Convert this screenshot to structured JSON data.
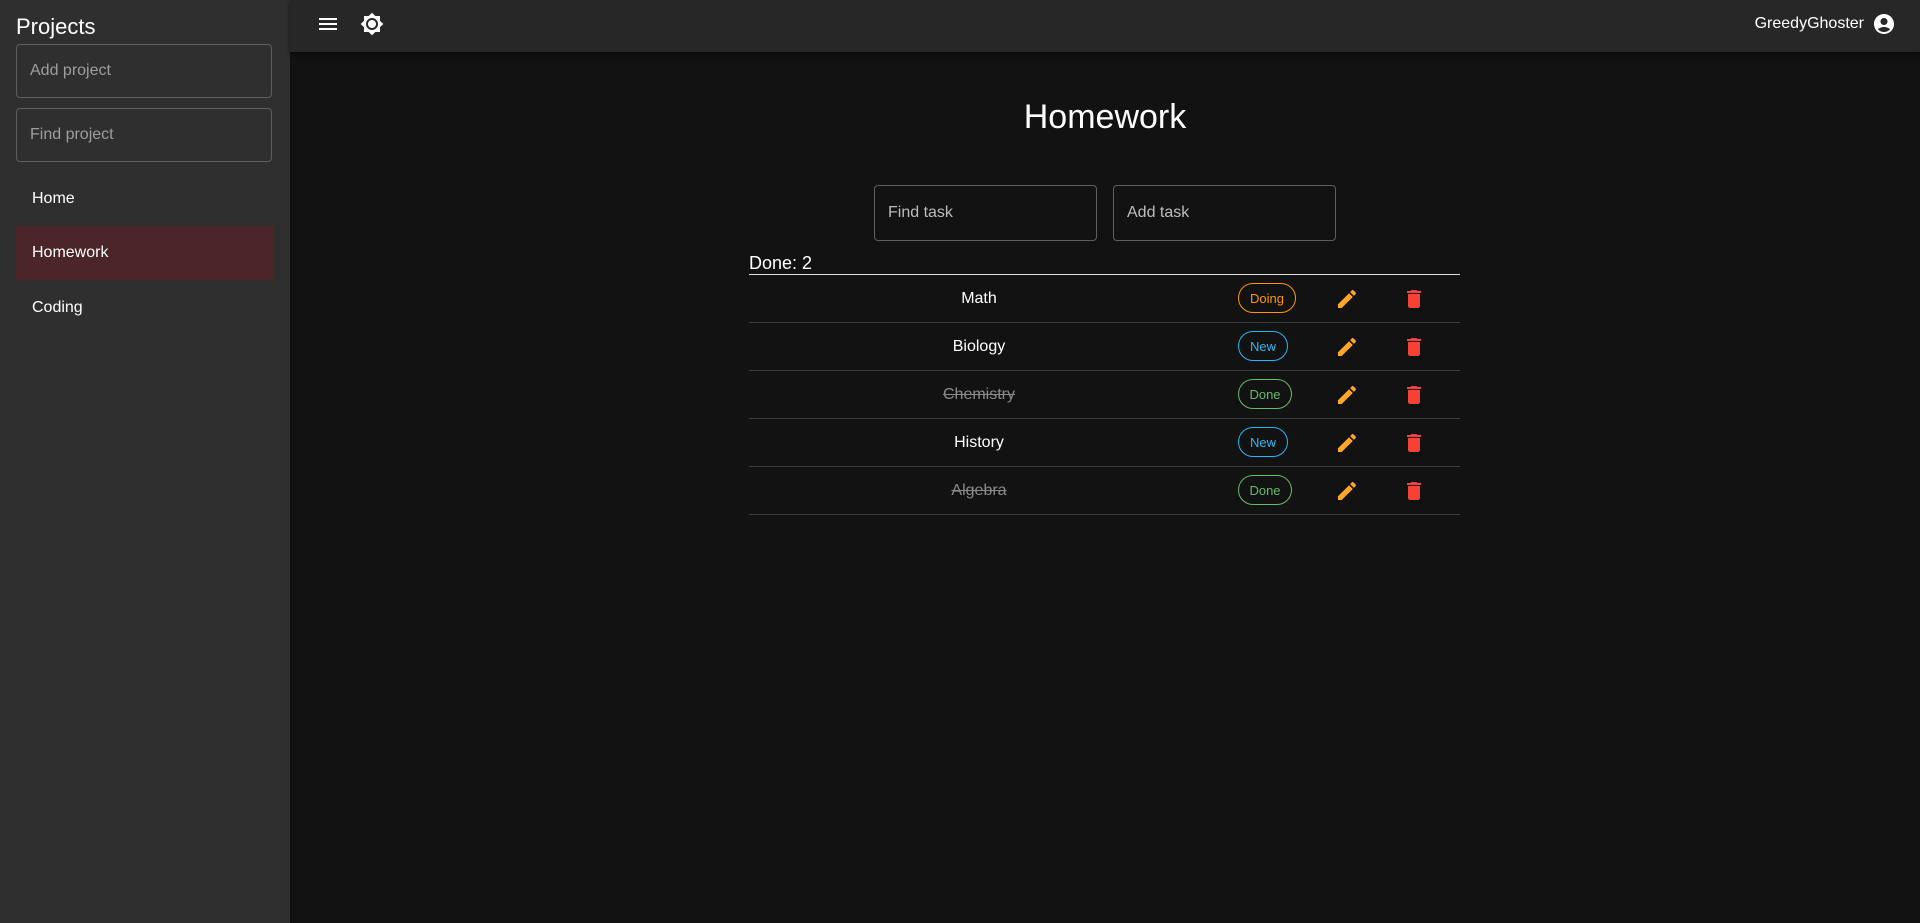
{
  "sidebar": {
    "title": "Projects",
    "add_project_placeholder": "Add project",
    "find_project_placeholder": "Find project",
    "items": [
      {
        "label": "Home",
        "active": false
      },
      {
        "label": "Homework",
        "active": true
      },
      {
        "label": "Coding",
        "active": false
      }
    ]
  },
  "topbar": {
    "menu_icon": "menu-icon",
    "theme_icon": "brightness-icon",
    "username": "GreedyGhoster",
    "account_icon": "account-circle-icon"
  },
  "main": {
    "title": "Homework",
    "find_task_placeholder": "Find task",
    "add_task_placeholder": "Add task",
    "done_count": "Done: 2",
    "tasks": [
      {
        "name": "Math",
        "status": "Doing",
        "completed": false
      },
      {
        "name": "Biology",
        "status": "New",
        "completed": false
      },
      {
        "name": "Chemistry",
        "status": "Done",
        "completed": true
      },
      {
        "name": "History",
        "status": "New",
        "completed": false
      },
      {
        "name": "Algebra",
        "status": "Done",
        "completed": true
      }
    ]
  },
  "colors": {
    "background": "#121212",
    "sidebar": "#2f2f2f",
    "topbar": "#272727",
    "active_item": "#4c2528",
    "doing": "#ff9800",
    "new": "#29b6f6",
    "done": "#66bb6a",
    "edit": "#ffa726",
    "delete": "#f44336"
  }
}
